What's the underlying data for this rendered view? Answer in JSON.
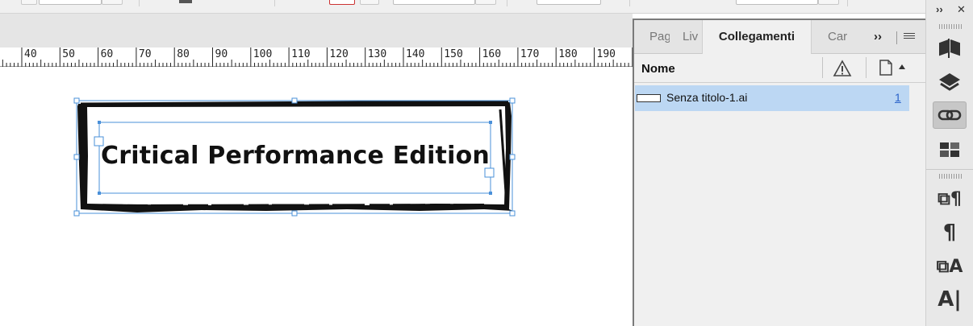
{
  "panel": {
    "tabs": [
      {
        "label": "Pag"
      },
      {
        "label": "Liv"
      },
      {
        "label": "Collegamenti"
      },
      {
        "label": "Car"
      }
    ],
    "more_label": "››",
    "header": {
      "name_label": "Nome"
    },
    "rows": [
      {
        "name": "Senza titolo-1.ai",
        "page": "1"
      }
    ]
  },
  "ruler": {
    "labels": [
      "40",
      "50",
      "60",
      "70",
      "80",
      "90",
      "100",
      "110",
      "120",
      "130",
      "140",
      "150",
      "160",
      "170",
      "180",
      "190"
    ]
  },
  "document": {
    "text": "Critical Performance Edition"
  },
  "dock": {
    "collapse_label": "››",
    "close_label": "✕",
    "icons": [
      "pages-icon",
      "layers-icon",
      "links-icon",
      "swatches-icon",
      "paragraph-styles-icon",
      "paragraph-icon",
      "character-styles-icon",
      "character-icon"
    ]
  },
  "colors": {
    "selection": "#bcd7f3",
    "frame_handle": "#4a90d9",
    "link_number": "#2a62c9"
  }
}
